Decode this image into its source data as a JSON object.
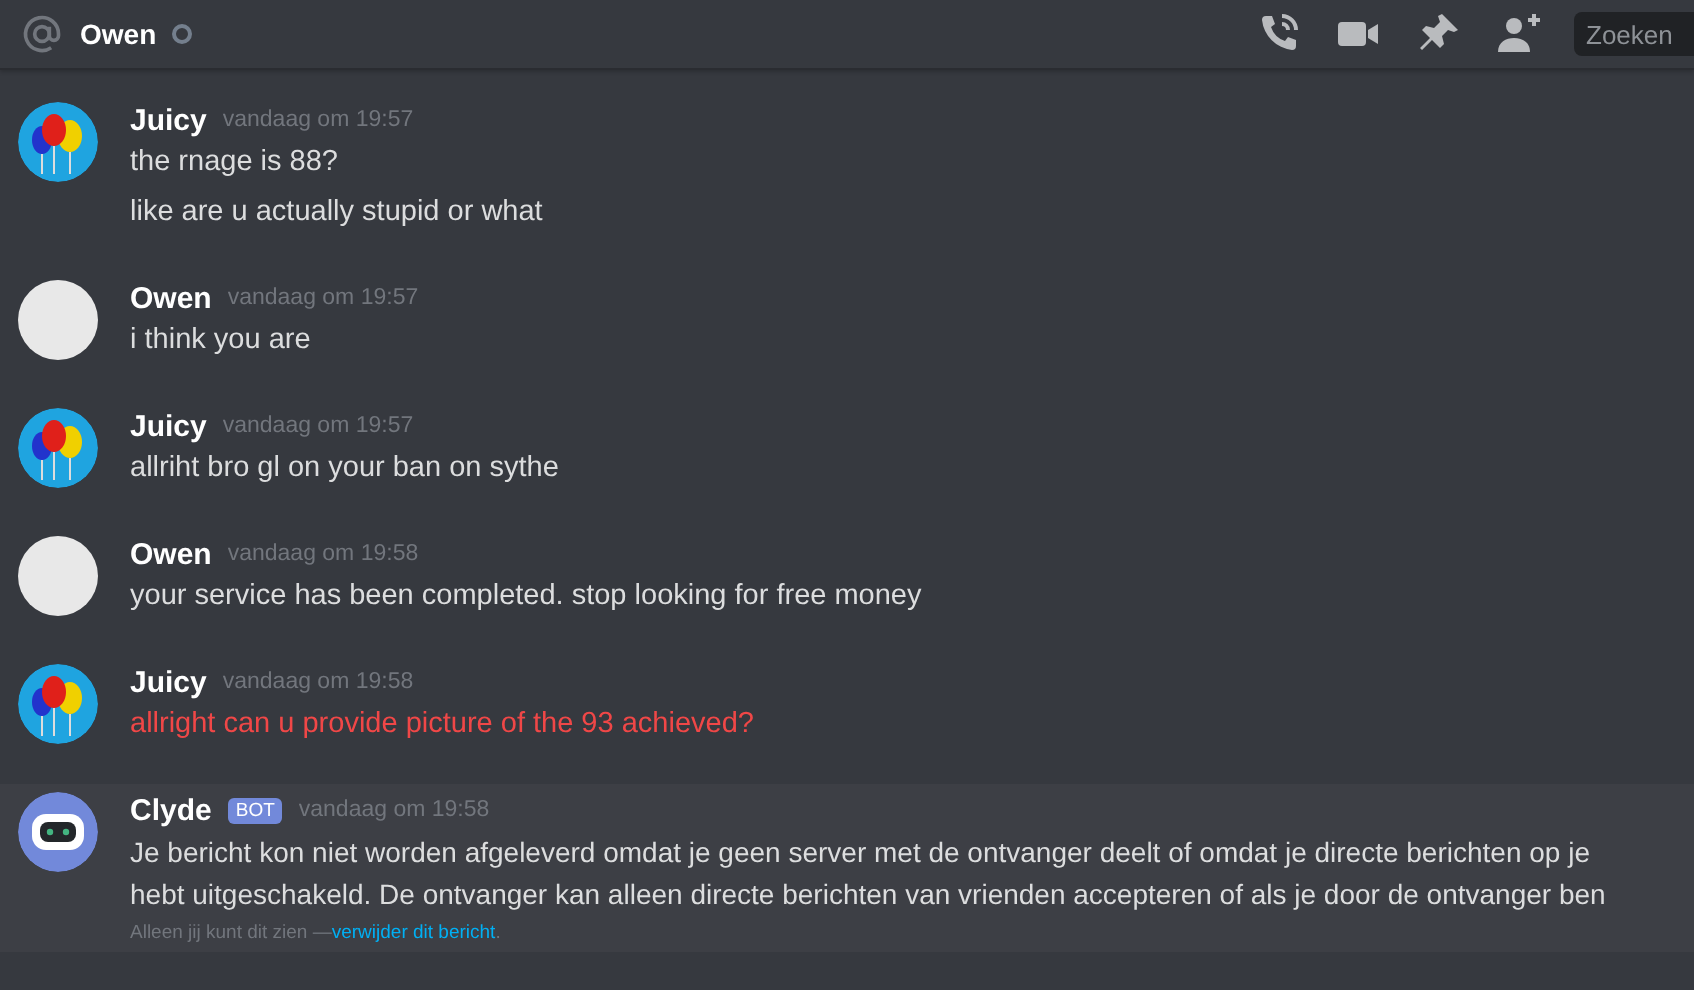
{
  "header": {
    "title": "Owen",
    "online": false,
    "search": {
      "placeholder": "Zoeken"
    }
  },
  "messages": [
    {
      "author": "Juicy",
      "kind": "balloons",
      "time": "vandaag om 19:57",
      "bot": false,
      "lines": [
        "the rnage is 88?",
        "like are u actually stupid or what"
      ],
      "failed": false,
      "ephemeral": false
    },
    {
      "author": "Owen",
      "kind": "photo",
      "time": "vandaag om 19:57",
      "bot": false,
      "lines": [
        "i think you are"
      ],
      "failed": false,
      "ephemeral": false
    },
    {
      "author": "Juicy",
      "kind": "balloons",
      "time": "vandaag om 19:57",
      "bot": false,
      "lines": [
        "allriht bro gl on your ban on sythe"
      ],
      "failed": false,
      "ephemeral": false
    },
    {
      "author": "Owen",
      "kind": "photo",
      "time": "vandaag om 19:58",
      "bot": false,
      "lines": [
        "your service has been completed. stop looking for free money"
      ],
      "failed": false,
      "ephemeral": false
    },
    {
      "author": "Juicy",
      "kind": "balloons",
      "time": "vandaag om 19:58",
      "bot": false,
      "lines": [
        "allright can u provide picture of the 93 achieved?"
      ],
      "failed": true,
      "ephemeral": false
    },
    {
      "author": "Clyde",
      "kind": "bot",
      "time": "vandaag om 19:58",
      "bot": true,
      "badge": "BOT",
      "lines": [
        "Je bericht kon niet worden afgeleverd omdat je geen server met de ontvanger deelt of omdat je directe berichten op je",
        "hebt uitgeschakeld. De ontvanger kan alleen directe berichten van vrienden accepteren of als je door de ontvanger ben"
      ],
      "failed": false,
      "ephemeral": true,
      "note": "Alleen jij kunt dit zien —",
      "note_link": "verwijder dit bericht",
      "note_end": "."
    }
  ]
}
